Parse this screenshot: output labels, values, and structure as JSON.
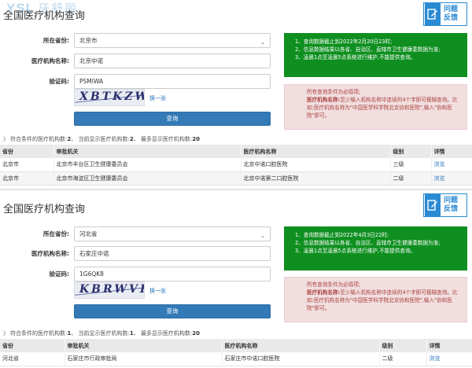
{
  "colors": {
    "green_notice": "#0e8f1f",
    "pink_notice": "#f2dede",
    "primary_button": "#337ab7",
    "feedback_blue": "#2a8ad4"
  },
  "panels": [
    {
      "watermark": {
        "latin": "YSL",
        "cn": "牙舒丽"
      },
      "title": "全国医疗机构查询",
      "feedback": {
        "line1": "问题",
        "line2": "反馈",
        "icon": "feedback-edit-icon"
      },
      "form": {
        "province_label": "所在省份:",
        "province_value": "北京市",
        "name_label": "医疗机构名称:",
        "name_value": "北京中诺",
        "captcha_label": "验证码:",
        "captcha_value": "PSMIWA",
        "captcha_image_text": "XBTKZW",
        "refresh_label": "换一张",
        "query_label": "查询"
      },
      "notice_green": [
        "1、查询数据截止到2022年2月20日23时;",
        "2、信息数据结果以各省、自治区、直辖市卫生健康委数据为准;",
        "3、凌晨1点至凌晨5点系统进行维护,不能提供查询。"
      ],
      "notice_pink": {
        "line1": "所有查询条件为必填项;",
        "bold": "医疗机构名称:",
        "rest": "至少输入机构名称中连续的4个字即可模糊查询。比如:医疗机构名称为\"中国医学科学院北京协和医院\",输入\"协和医院\"即可。"
      },
      "summary": {
        "t1": "符合条件的医疗机构数:",
        "v1": "2",
        "t2": "当前显示医疗机构数:",
        "v2": "2",
        "t3": "最多显示医疗机构数:",
        "v3": "20"
      },
      "table": {
        "headers": [
          "省份",
          "审批机关",
          "医疗机构名称",
          "级别",
          "详情"
        ],
        "rows": [
          [
            "北京市",
            "北京市丰台区卫生健康委员会",
            "北京中诺口腔医院",
            "三级",
            "浏览"
          ],
          [
            "北京市",
            "北京市海淀区卫生健康委员会",
            "北京中诺第二口腔医院",
            "二级",
            "浏览"
          ]
        ]
      }
    },
    {
      "title": "全国医疗机构查询",
      "feedback": {
        "line1": "问题",
        "line2": "反馈",
        "icon": "feedback-edit-icon"
      },
      "form": {
        "province_label": "所在省份:",
        "province_value": "河北省",
        "name_label": "医疗机构名称:",
        "name_value": "石家庄中诺",
        "captcha_label": "验证码:",
        "captcha_value": "1G6QK8",
        "captcha_image_text": "KBRWVK",
        "refresh_label": "换一张",
        "query_label": "查询"
      },
      "notice_green": [
        "1、查询数据截止到2022年4月3日22时;",
        "2、信息数据结果以各省、自治区、直辖市卫生健康委数据为准;",
        "3、凌晨1点至凌晨5点系统进行维护,不能提供查询。"
      ],
      "notice_pink": {
        "line1": "所有查询条件为必填项;",
        "bold": "医疗机构名称:",
        "rest": "至少输入机构名称中连续的4个字即可模糊查询。比如:医疗机构名称为\"中国医学科学院北京协和医院\",输入\"协和医院\"即可。"
      },
      "summary": {
        "t1": "符合条件的医疗机构数:",
        "v1": "1",
        "t2": "当前显示医疗机构数:",
        "v2": "1",
        "t3": "最多显示医疗机构数:",
        "v3": "20"
      },
      "table": {
        "headers": [
          "省份",
          "审批机关",
          "医疗机构名称",
          "级别",
          "详情"
        ],
        "rows": [
          [
            "河北省",
            "石家庄市行政审批局",
            "石家庄市中诺口腔医院",
            "二级",
            "浏览"
          ]
        ]
      }
    }
  ]
}
